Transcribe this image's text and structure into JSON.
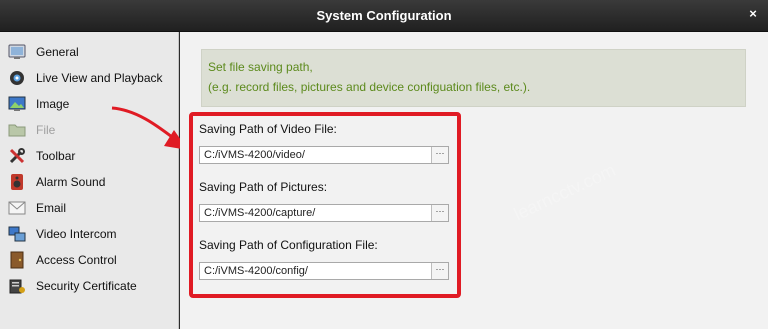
{
  "window": {
    "title": "System Configuration",
    "close_symbol": "×"
  },
  "sidebar": {
    "items": [
      {
        "label": "General",
        "icon": "general-icon",
        "disabled": false
      },
      {
        "label": "Live View and Playback",
        "icon": "camera-icon",
        "disabled": false
      },
      {
        "label": "Image",
        "icon": "image-icon",
        "disabled": false
      },
      {
        "label": "File",
        "icon": "folder-icon",
        "disabled": true
      },
      {
        "label": "Toolbar",
        "icon": "tools-icon",
        "disabled": false
      },
      {
        "label": "Alarm Sound",
        "icon": "speaker-icon",
        "disabled": false
      },
      {
        "label": "Email",
        "icon": "email-icon",
        "disabled": false
      },
      {
        "label": "Video Intercom",
        "icon": "intercom-icon",
        "disabled": false
      },
      {
        "label": "Access Control",
        "icon": "door-icon",
        "disabled": false
      },
      {
        "label": "Security Certificate",
        "icon": "certificate-icon",
        "disabled": false
      }
    ]
  },
  "info": {
    "line1": "Set file saving path,",
    "line2": "(e.g. record files, pictures and device configuation files, etc.)."
  },
  "paths": [
    {
      "label": "Saving Path of Video File:",
      "value": "C:/iVMS-4200/video/",
      "browse": "···"
    },
    {
      "label": "Saving Path of Pictures:",
      "value": "C:/iVMS-4200/capture/",
      "browse": "···"
    },
    {
      "label": "Saving Path of Configuration File:",
      "value": "C:/iVMS-4200/config/",
      "browse": "···"
    }
  ],
  "watermark": "learncctv.com",
  "colors": {
    "highlight": "#e01b24",
    "info_text": "#5c8a1c"
  }
}
